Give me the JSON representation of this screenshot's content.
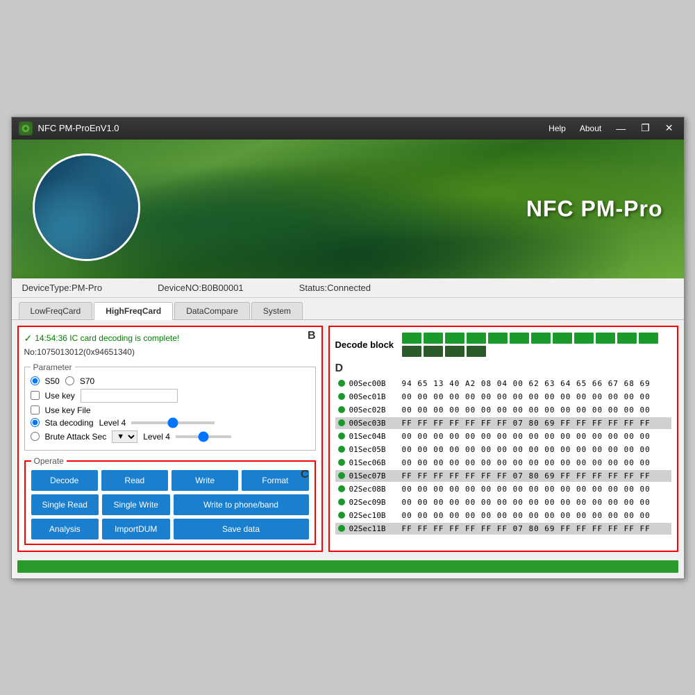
{
  "app": {
    "title": "NFC PM-ProEnV1.0",
    "banner_title": "NFC PM-Pro",
    "help": "Help",
    "about": "About",
    "minimize": "—",
    "maximize": "❐",
    "close": "✕"
  },
  "statusbar": {
    "device_type": "DeviceType:PM-Pro",
    "device_no": "DeviceNO:B0B00001",
    "status": "Status:Connected"
  },
  "tabs": [
    {
      "label": "LowFreqCard",
      "active": false
    },
    {
      "label": "HighFreqCard",
      "active": true
    },
    {
      "label": "DataCompare",
      "active": false
    },
    {
      "label": "System",
      "active": false
    }
  ],
  "params": {
    "title": "Parameter",
    "s50_label": "S50",
    "s70_label": "S70",
    "use_key_label": "Use key",
    "use_key_file_label": "Use key File",
    "sta_decoding_label": "Sta decoding",
    "level_label": "Level 4",
    "brute_label": "Brute Attack Sec",
    "level2_label": "Level 4"
  },
  "status_msg": {
    "icon": "✓",
    "text": "14:54:36 IC card decoding is complete!",
    "no_text": "No:1075013012(0x94651340)"
  },
  "operate": {
    "title": "Operate",
    "label": "C",
    "buttons_row1": [
      {
        "label": "Decode",
        "name": "decode-btn"
      },
      {
        "label": "Read",
        "name": "read-btn"
      },
      {
        "label": "Write",
        "name": "write-btn"
      },
      {
        "label": "Format",
        "name": "format-btn"
      }
    ],
    "buttons_row2": [
      {
        "label": "Single Read",
        "name": "single-read-btn"
      },
      {
        "label": "Single Write",
        "name": "single-write-btn"
      },
      {
        "label": "Write to phone/band",
        "name": "write-phone-btn"
      }
    ],
    "buttons_row3": [
      {
        "label": "Analysis",
        "name": "analysis-btn"
      },
      {
        "label": "ImportDUM",
        "name": "import-btn"
      },
      {
        "label": "Save data",
        "name": "save-btn"
      }
    ]
  },
  "left_label": "B",
  "right_label": "D",
  "decode_block_label": "Decode block",
  "decode_blocks_count": 16,
  "data_rows": [
    {
      "label": "00Sec00B",
      "values": "94 65 13 40 A2 08 04 00 62 63 64 65 66 67 68 69",
      "highlight": false
    },
    {
      "label": "00Sec01B",
      "values": "00 00 00 00 00 00 00 00 00 00 00 00 00 00 00 00",
      "highlight": false
    },
    {
      "label": "00Sec02B",
      "values": "00 00 00 00 00 00 00 00 00 00 00 00 00 00 00 00",
      "highlight": false
    },
    {
      "label": "00Sec03B",
      "values": "FF FF FF FF FF FF FF 07 80 69 FF FF FF FF FF FF",
      "highlight": true
    },
    {
      "label": "01Sec04B",
      "values": "00 00 00 00 00 00 00 00 00 00 00 00 00 00 00 00",
      "highlight": false
    },
    {
      "label": "01Sec05B",
      "values": "00 00 00 00 00 00 00 00 00 00 00 00 00 00 00 00",
      "highlight": false
    },
    {
      "label": "01Sec06B",
      "values": "00 00 00 00 00 00 00 00 00 00 00 00 00 00 00 00",
      "highlight": false
    },
    {
      "label": "01Sec07B",
      "values": "FF FF FF FF FF FF FF 07 80 69 FF FF FF FF FF FF",
      "highlight": true
    },
    {
      "label": "02Sec08B",
      "values": "00 00 00 00 00 00 00 00 00 00 00 00 00 00 00 00",
      "highlight": false
    },
    {
      "label": "02Sec09B",
      "values": "00 00 00 00 00 00 00 00 00 00 00 00 00 00 00 00",
      "highlight": false
    },
    {
      "label": "02Sec10B",
      "values": "00 00 00 00 00 00 00 00 00 00 00 00 00 00 00 00",
      "highlight": false
    },
    {
      "label": "02Sec11B",
      "values": "FF FF FF FF FF FF FF 07 80 69 FF FF FF FF FF FF",
      "highlight": true
    }
  ]
}
